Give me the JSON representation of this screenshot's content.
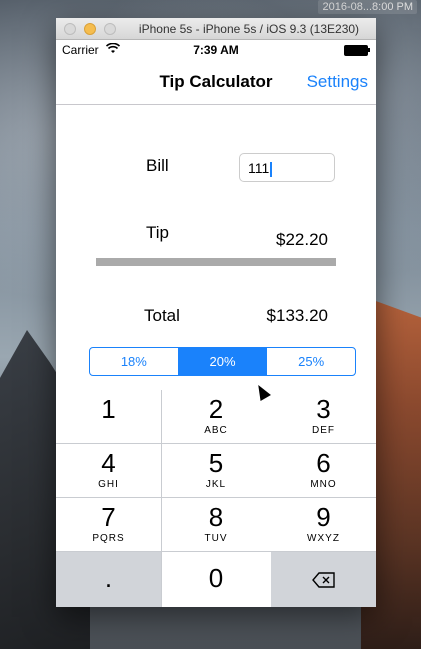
{
  "desktop": {
    "clock": "2016-08...8:00 PM"
  },
  "window": {
    "title": "iPhone 5s - iPhone 5s / iOS 9.3 (13E230)"
  },
  "status_bar": {
    "carrier": "Carrier",
    "time": "7:39 AM"
  },
  "nav": {
    "title": "Tip Calculator",
    "settings": "Settings"
  },
  "form": {
    "bill_label": "Bill",
    "bill_value": "111",
    "tip_label": "Tip",
    "tip_value": "$22.20",
    "total_label": "Total",
    "total_value": "$133.20"
  },
  "tip_options": {
    "segments": [
      "18%",
      "20%",
      "25%"
    ],
    "selected": "20%"
  },
  "keypad": {
    "keys": [
      {
        "digit": "1",
        "letters": ""
      },
      {
        "digit": "2",
        "letters": "ABC"
      },
      {
        "digit": "3",
        "letters": "DEF"
      },
      {
        "digit": "4",
        "letters": "GHI"
      },
      {
        "digit": "5",
        "letters": "JKL"
      },
      {
        "digit": "6",
        "letters": "MNO"
      },
      {
        "digit": "7",
        "letters": "PQRS"
      },
      {
        "digit": "8",
        "letters": "TUV"
      },
      {
        "digit": "9",
        "letters": "WXYZ"
      },
      {
        "digit": ".",
        "letters": ""
      },
      {
        "digit": "0",
        "letters": ""
      },
      {
        "digit": "⌫",
        "letters": ""
      }
    ]
  },
  "colors": {
    "accent": "#1a82fb",
    "keypad_bg": "#c9ccd1"
  }
}
